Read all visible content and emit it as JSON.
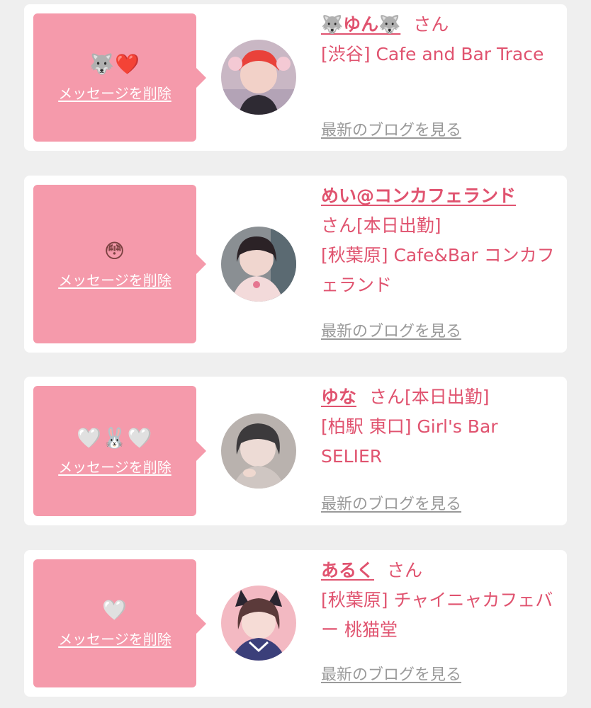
{
  "common": {
    "delete_label": "メッセージを削除",
    "blog_label": "最新のブログを見る"
  },
  "colors": {
    "accent": "#e0536f",
    "bubble": "#f59aab",
    "background": "#efefef",
    "card": "#ffffff",
    "link_gray": "#9a9a9a"
  },
  "messages": [
    {
      "message": "🐺❤️",
      "name": "🐺ゆん🐺",
      "honorific": "さん",
      "venue": "[渋谷] Cafe and Bar Trace"
    },
    {
      "message": "😳",
      "name": "めい@コンカフェランド",
      "honorific": "さん[本日出勤]",
      "venue": "[秋葉原] Cafe&Bar コンカフェランド"
    },
    {
      "message": "🤍🐰🤍",
      "name": "ゆな",
      "honorific": "さん[本日出勤]",
      "venue": "[柏駅 東口] Girl's Bar SELIER"
    },
    {
      "message": "🤍",
      "name": "あるく",
      "honorific": "さん",
      "venue": "[秋葉原] チャイニャカフェバー 桃猫堂"
    }
  ]
}
